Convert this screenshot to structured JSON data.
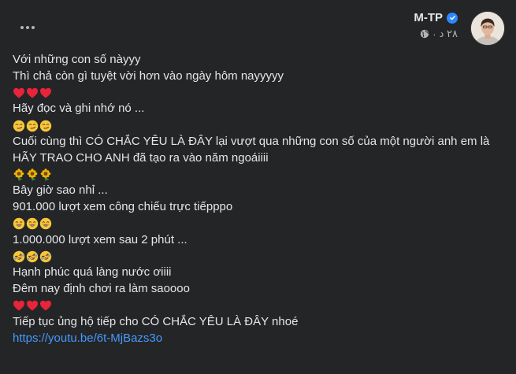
{
  "header": {
    "author": "M-TP",
    "timestamp": "٢٨ د",
    "more_icon": "more-horizontal-icon",
    "privacy_icon": "globe-icon",
    "verified_icon": "verified-badge-icon"
  },
  "post": {
    "lines": [
      "Với những con số nàyyy",
      "Thì chả còn gì tuyệt vời hơn vào ngày hôm nayyyyy",
      "Hãy đọc và ghi nhớ nó ...",
      "Cuối cùng thì CÓ CHẮC YÊU LÀ ĐÂY lại vượt qua những con số của một người anh em là HÃY TRAO CHO ANH đã tạo ra vào năm ngoáiiii",
      "Bây giờ sao nhỉ ...",
      "901.000 lượt xem công chiếu trực tiếpppo",
      "1.000.000 lượt xem sau 2 phút ...",
      "Hạnh phúc quá làng nước ơiiii",
      "Đêm nay định chơi ra làm saoooo",
      "Tiếp tục ủng hộ tiếp cho CÓ CHẮC YÊU LÀ ĐÂY nhoé"
    ],
    "emoji_rows": [
      "red-heart-icon",
      "smirk-face-icon",
      "sunflower-icon",
      "grinning-face-icon",
      "rofl-face-icon",
      "red-heart-icon"
    ],
    "link": "https://youtu.be/6t-MjBazs3o"
  },
  "colors": {
    "background": "#242526",
    "text": "#e4e6eb",
    "secondary_text": "#b0b3b8",
    "link": "#4599ff",
    "verified": "#2d88ff"
  }
}
